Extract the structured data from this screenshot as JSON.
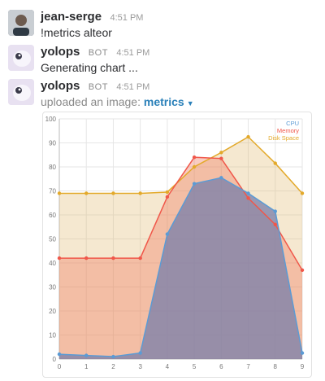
{
  "messages": [
    {
      "author": "jean-serge",
      "badge": "",
      "time": "4:51 PM",
      "text": "!metrics alteor"
    },
    {
      "author": "yolops",
      "badge": "BOT",
      "time": "4:51 PM",
      "text": "Generating chart ..."
    },
    {
      "author": "yolops",
      "badge": "BOT",
      "time": "4:51 PM",
      "text": "uploaded an image:",
      "file_name": "metrics"
    }
  ],
  "colors": {
    "cpu": "#5b9bd5",
    "memory": "#f0574a",
    "disk": "#e3a92a",
    "link": "#2a80b9"
  },
  "chart_data": {
    "type": "area",
    "x": [
      0,
      1,
      2,
      3,
      4,
      5,
      6,
      7,
      8,
      9
    ],
    "xlim": [
      0,
      9
    ],
    "ylim": [
      0,
      100
    ],
    "yticks": [
      0,
      10,
      20,
      30,
      40,
      50,
      60,
      70,
      80,
      90,
      100
    ],
    "grid": true,
    "legend_position": "top-right",
    "series": [
      {
        "name": "CPU",
        "color": "#5b9bd5",
        "values": [
          2,
          1.5,
          1,
          2.5,
          52,
          73,
          75.5,
          69,
          61.5,
          2.5
        ]
      },
      {
        "name": "Memory",
        "color": "#f0574a",
        "values": [
          42,
          42,
          42,
          42,
          67.5,
          84,
          83.5,
          67,
          56,
          37
        ]
      },
      {
        "name": "Disk Space",
        "color": "#e3a92a",
        "values": [
          69,
          69,
          69,
          69,
          69.5,
          80,
          86,
          92.5,
          81.5,
          69
        ]
      }
    ]
  }
}
